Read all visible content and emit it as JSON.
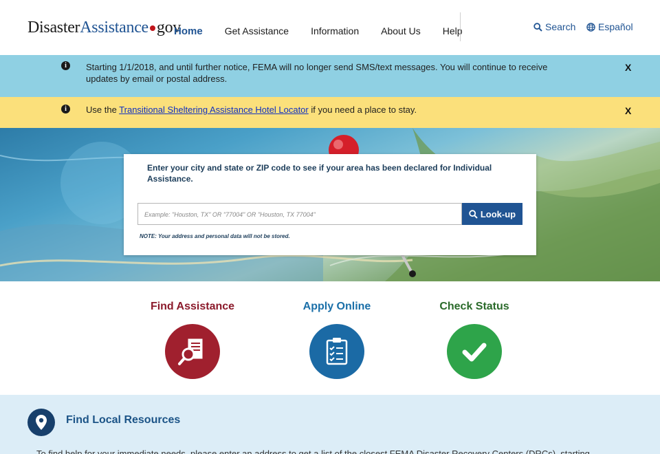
{
  "header": {
    "logo_main": "Disaster",
    "logo_accent": "Assistance",
    "logo_suffix": "gov",
    "nav": [
      {
        "label": "Home",
        "active": true
      },
      {
        "label": "Get Assistance",
        "active": false
      },
      {
        "label": "Information",
        "active": false
      },
      {
        "label": "About Us",
        "active": false
      },
      {
        "label": "Help",
        "active": false
      }
    ],
    "search_label": "Search",
    "language_label": "Español"
  },
  "alerts": {
    "sms": {
      "text": "Starting 1/1/2018, and until further notice, FEMA will no longer send SMS/text messages. You will continue to receive updates by email or postal address.",
      "close": "X"
    },
    "shelter": {
      "prefix": "Use the ",
      "link": "Transitional Sheltering Assistance Hotel Locator",
      "suffix": " if you need a place to stay.",
      "close": "X"
    }
  },
  "lookup": {
    "prompt": "Enter your city and state or ZIP code to see if your area has been declared for Individual Assistance.",
    "placeholder": "Example: \"Houston, TX\" OR \"77004\" OR \"Houston, TX 77004\"",
    "button": "Look-up",
    "note": "NOTE: Your address and personal data will not be stored."
  },
  "actions": [
    {
      "label": "Find Assistance",
      "icon": "find-assistance-icon",
      "color": "#a0202e"
    },
    {
      "label": "Apply Online",
      "icon": "apply-online-icon",
      "color": "#1b6aa5"
    },
    {
      "label": "Check Status",
      "icon": "check-status-icon",
      "color": "#2ea44a"
    }
  ],
  "local_resources": {
    "heading": "Find Local Resources",
    "text": "To find help for your immediate needs, please enter an address to get a list of the closest FEMA Disaster Recovery Centers (DRCs), starting"
  },
  "colors": {
    "brand_blue": "#205493",
    "alert_blue": "#8fd0e3",
    "alert_yellow": "#fbe07b",
    "logo_dot": "#c0151b"
  }
}
